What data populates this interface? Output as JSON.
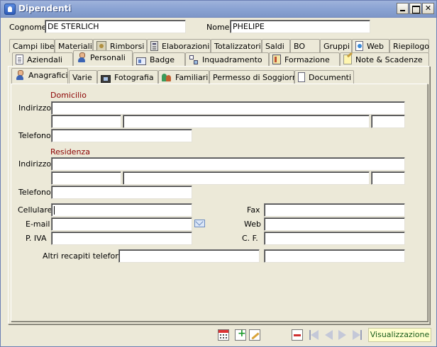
{
  "window": {
    "title": "Dipendenti"
  },
  "header": {
    "cognome_label": "Cognome",
    "cognome_value": "DE STERLICH",
    "nome_label": "Nome",
    "nome_value": "PHELIPE"
  },
  "tabs_row1": [
    {
      "label": "Campi liberi"
    },
    {
      "label": "Materiali"
    },
    {
      "label": "Rimborsi",
      "icon": "money-icon"
    },
    {
      "label": "Elaborazioni",
      "icon": "calculator-icon"
    },
    {
      "label": "Totalizzatori"
    },
    {
      "label": "Saldi"
    },
    {
      "label": "BO"
    },
    {
      "label": "Gruppi"
    },
    {
      "label": "Web",
      "icon": "web-icon"
    },
    {
      "label": "Riepilogo"
    }
  ],
  "tabs_row2": [
    {
      "label": "Aziendali",
      "icon": "document-icon"
    },
    {
      "label": "Personali",
      "icon": "person-icon",
      "active": true
    },
    {
      "label": "Badge",
      "icon": "badge-icon"
    },
    {
      "label": "Inquadramento",
      "icon": "hierarchy-icon"
    },
    {
      "label": "Formazione",
      "icon": "book-icon"
    },
    {
      "label": "Note & Scadenze",
      "icon": "note-icon"
    }
  ],
  "subtabs": [
    {
      "label": "Anagrafici",
      "icon": "person-icon",
      "active": true
    },
    {
      "label": "Varie"
    },
    {
      "label": "Fotografia",
      "icon": "film-icon"
    },
    {
      "label": "Familiari",
      "icon": "family-icon"
    },
    {
      "label": "Permesso di Soggiorno"
    },
    {
      "label": "Documenti",
      "icon": "documents-icon"
    }
  ],
  "form": {
    "domicilio_title": "Domicilio",
    "residenza_title": "Residenza",
    "indirizzo_label": "Indirizzo",
    "telefono_label": "Telefono",
    "cellulare_label": "Cellulare",
    "email_label": "E-mail",
    "piva_label": "P. IVA",
    "fax_label": "Fax",
    "web_label": "Web",
    "cf_label": "C. F.",
    "altri_label": "Altri recapiti telefonici"
  },
  "status": {
    "mode": "Visualizzazione"
  },
  "icons": {
    "toolbar": [
      "calendar-icon",
      "add-icon",
      "edit-icon",
      "delete-icon",
      "first-record-icon",
      "previous-record-icon",
      "next-record-icon",
      "last-record-icon"
    ],
    "email_action": "envelope-icon"
  },
  "colors": {
    "section_title": "#8b0000",
    "window_face": "#ece9d8",
    "titlebar": "#8aa3d3",
    "status_badge_bg": "#ffffcc"
  }
}
